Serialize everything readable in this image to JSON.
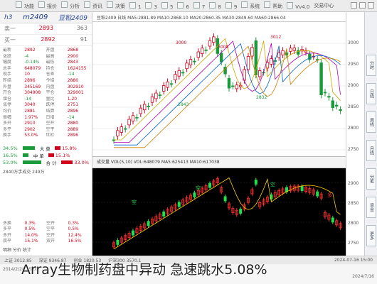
{
  "topbar": {
    "items": [
      "功能",
      "报价",
      "分析",
      "资讯",
      "决策",
      "1",
      "3",
      "5",
      "6",
      "7",
      "8",
      "9",
      "系统",
      "帮助",
      "Vv4.0"
    ],
    "right_label": "交易中心"
  },
  "quote_panel": {
    "header_left": "h3",
    "header_code": "m2409",
    "header_right": "豆粕2409",
    "bid_label": "卖一",
    "bid_value": "2893",
    "bid_vol": "363",
    "ask_label": "买一",
    "ask_value": "2892",
    "ask_vol": "91",
    "rows": [
      {
        "a": "最新",
        "b": "2892",
        "c": "开盘",
        "d": "2868"
      },
      {
        "a": "涨跌",
        "b": "-4",
        "c": "最高",
        "d": "2900"
      },
      {
        "a": "幅度",
        "b": "-0.14%",
        "c": "最低",
        "d": "2843"
      },
      {
        "a": "总手",
        "b": "648079",
        "c": "持仓",
        "d": "1624155"
      },
      {
        "a": "现手",
        "b": "10",
        "c": "仓差",
        "d": "-14"
      },
      {
        "a": "昨结",
        "b": "2896",
        "c": "今结",
        "d": "2880"
      },
      {
        "a": "外盘",
        "b": "345169",
        "c": "内盘",
        "d": "302910"
      },
      {
        "a": "开仓",
        "b": "304908",
        "c": "平仓",
        "d": "329001"
      },
      {
        "a": "增仓",
        "b": "-14",
        "c": "量比",
        "d": "1.20"
      },
      {
        "a": "涨停",
        "b": "3040",
        "c": "跌停",
        "d": "2751"
      },
      {
        "a": "均价",
        "b": "2881",
        "c": "结算",
        "d": "2896"
      },
      {
        "a": "振幅",
        "b": "1.97%",
        "c": "日增",
        "d": "-14"
      },
      {
        "a": "多开",
        "b": "2910",
        "c": "空开",
        "d": "2880"
      },
      {
        "a": "多平",
        "b": "2902",
        "c": "空平",
        "d": "2889"
      },
      {
        "a": "换手",
        "b": "53.0%",
        "c": "红杠",
        "d": "2896"
      }
    ],
    "flow": [
      {
        "left": "34.5%",
        "label": "大 单",
        "right": "15.8%"
      },
      {
        "left": "16.5%",
        "label": "中 单",
        "right": "15.1%"
      },
      {
        "left": "53.0%",
        "label": "合 计",
        "right": "33.0%"
      }
    ],
    "flow_footer": "2840万手成交 249万",
    "bottom_rows": [
      {
        "a": "多换",
        "b": "0.3%",
        "c": "空开",
        "d": "0.3%"
      },
      {
        "a": "多平",
        "b": "0.5%",
        "c": "空平",
        "d": "0.5%"
      },
      {
        "a": "多开",
        "b": "14.0%",
        "c": "空开",
        "d": "12.4%"
      },
      {
        "a": "双平",
        "b": "15.1%",
        "c": "双开",
        "d": "16.5%"
      }
    ],
    "bottom_footer": "明细 分价 统计"
  },
  "chart": {
    "title_bar": "豆粕2409 日线 MA5:2881.89 MA10:2868.10 MA20:2860.35 MA30:2849.60 MA60:2866.04",
    "legend_bar": "成交量 VOL(5,10) VOL:648079 MA5:625413 MA10:617038",
    "price_labels": [
      {
        "text": "3000",
        "color": "#d0021b"
      },
      {
        "text": "3008",
        "color": "#d0021b"
      },
      {
        "text": "3012",
        "color": "#d0021b"
      },
      {
        "text": "2843",
        "color": "#1a9a3a"
      },
      {
        "text": "2832",
        "color": "#1a9a3a"
      }
    ],
    "axis_ticks": [
      "3000",
      "2950",
      "2900",
      "2850",
      "2800",
      "2750"
    ],
    "axis_ticks_bottom": [
      "2900",
      "2850",
      "2800",
      "2750"
    ],
    "bottom_marks": [
      "空",
      "空",
      "空",
      "多"
    ]
  },
  "side_tabs": [
    "分时",
    "日线",
    "周线",
    "月线",
    "分笔",
    "资金",
    "更多"
  ],
  "status_bar": {
    "items": [
      "上证 3012.85",
      "深证 9346.87",
      "创业 1820.53",
      "沪深300 3570.1"
    ],
    "time": "2024-07-16 15:00"
  },
  "caption": "Array生物制药盘中异动 急速跳水5.08%",
  "taskbar": {
    "left": "2014/2/28 15:00",
    "right": "2024/7/16"
  }
}
